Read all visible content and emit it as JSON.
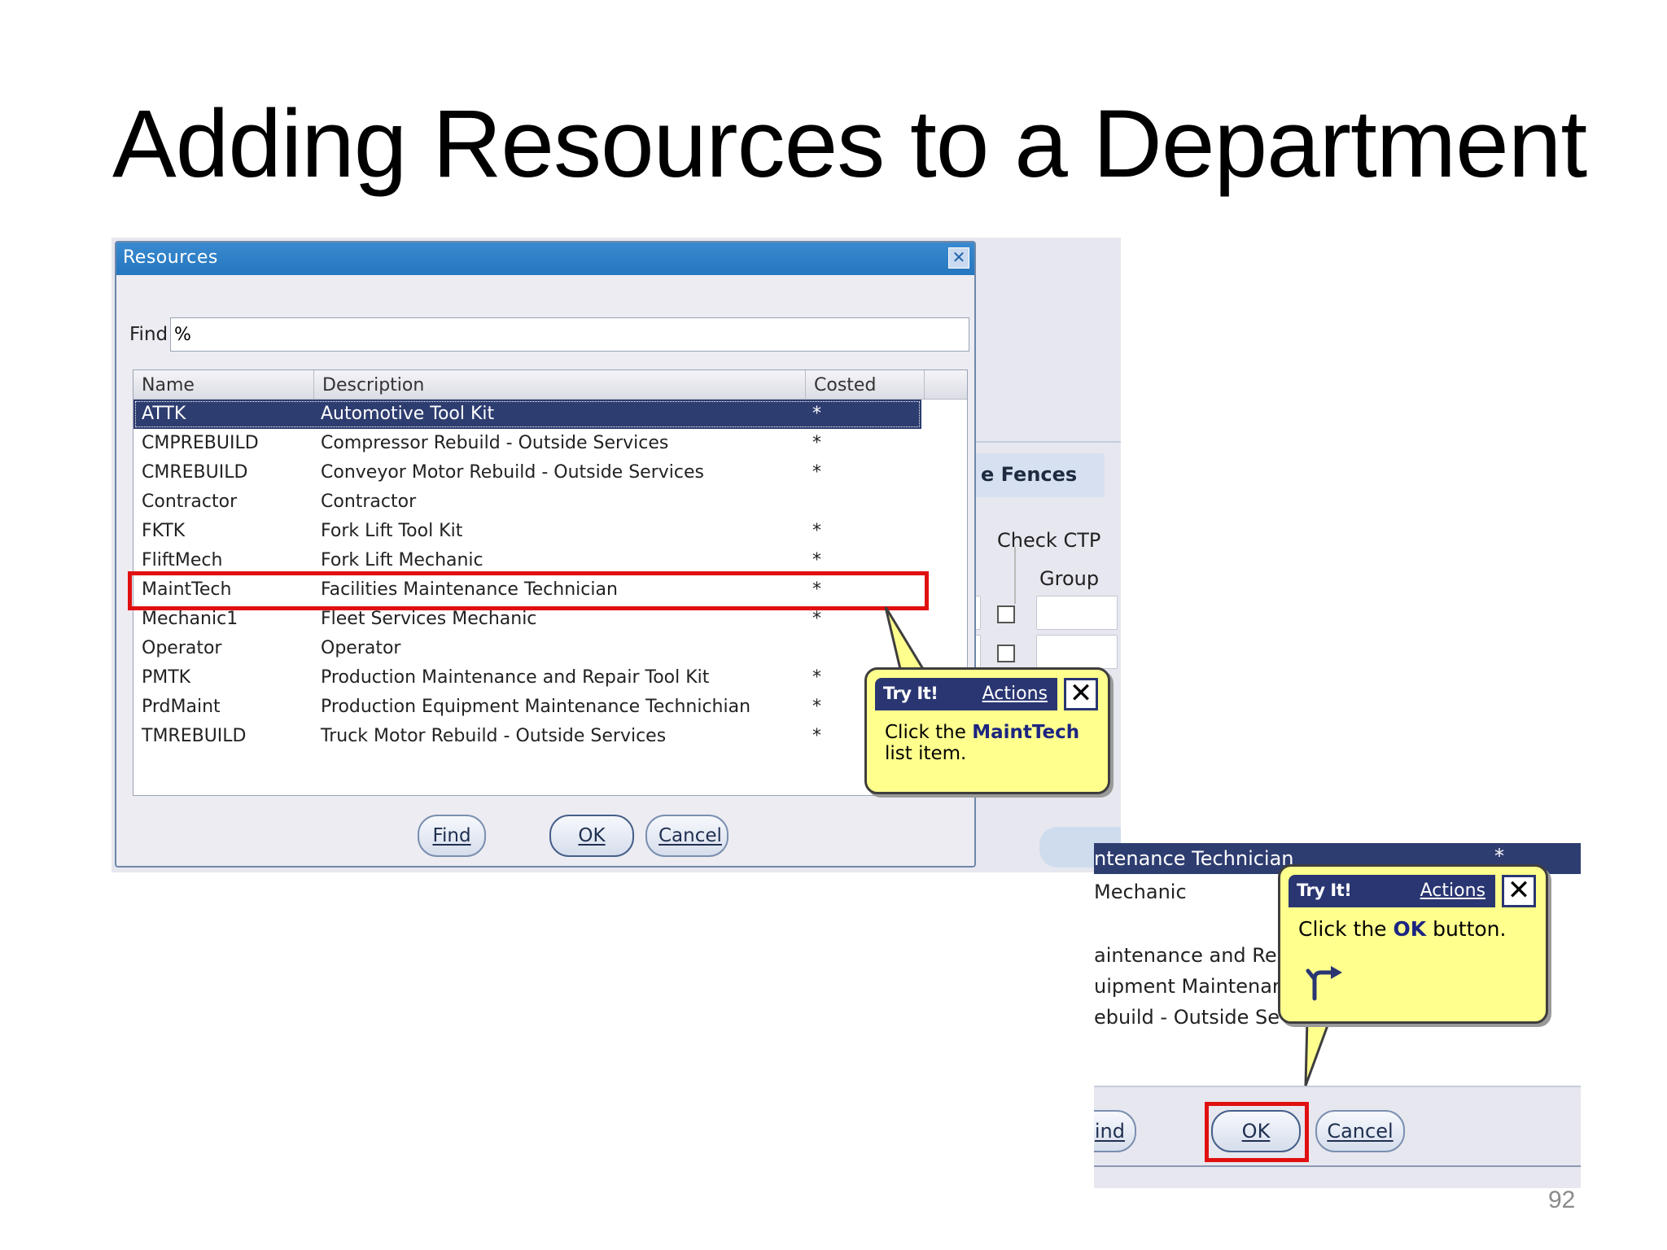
{
  "slide": {
    "title": "Adding Resources to a Department",
    "page_number": "92"
  },
  "dialog": {
    "title": "Resources",
    "close_glyph": "✕",
    "find_label": "Find",
    "find_value": "%",
    "columns": [
      "Name",
      "Description",
      "Costed"
    ],
    "rows": [
      {
        "name": "ATTK",
        "description": "Automotive Tool Kit",
        "costed": "*"
      },
      {
        "name": "CMPREBUILD",
        "description": "Compressor Rebuild - Outside Services",
        "costed": "*"
      },
      {
        "name": "CMREBUILD",
        "description": "Conveyor Motor Rebuild - Outside Services",
        "costed": "*"
      },
      {
        "name": "Contractor",
        "description": "Contractor",
        "costed": ""
      },
      {
        "name": "FKTK",
        "description": "Fork Lift Tool Kit",
        "costed": "*"
      },
      {
        "name": "FliftMech",
        "description": "Fork Lift Mechanic",
        "costed": "*"
      },
      {
        "name": "MaintTech",
        "description": "Facilities Maintenance Technician",
        "costed": "*"
      },
      {
        "name": "Mechanic1",
        "description": "Fleet Services Mechanic",
        "costed": "*"
      },
      {
        "name": "Operator",
        "description": "Operator",
        "costed": ""
      },
      {
        "name": "PMTK",
        "description": "Production Maintenance and Repair Tool Kit",
        "costed": "*"
      },
      {
        "name": "PrdMaint",
        "description": "Production Equipment Maintenance Technichian",
        "costed": "*"
      },
      {
        "name": "TMREBUILD",
        "description": "Truck Motor Rebuild - Outside Services",
        "costed": "*"
      }
    ],
    "buttons": {
      "find": "Find",
      "ok": "OK",
      "cancel": "Cancel"
    }
  },
  "background_form": {
    "tab_label": "e Fences",
    "check_ctp_label": "Check CTP",
    "group_label": "Group"
  },
  "tooltip1": {
    "header": "Try It!",
    "actions_link": "Actions",
    "close_glyph": "✕",
    "text_before": "Click the ",
    "text_bold": "MaintTech",
    "text_after": " list item."
  },
  "tooltip2": {
    "header": "Try It!",
    "actions_link": "Actions",
    "close_glyph": "✕",
    "text_before": "Click the ",
    "text_bold": "OK",
    "text_after": " button.",
    "icon": "branch-arrow-icon"
  },
  "shot2": {
    "selected_fragment": "ntenance Technician",
    "selected_costed": "*",
    "fragments": [
      "Mechanic",
      "aintenance and Rep",
      "uipment Maintenan",
      "ebuild - Outside Se"
    ],
    "buttons": {
      "find": "ind",
      "ok": "OK",
      "cancel": "Cancel"
    }
  },
  "colors": {
    "titlebar": "#2476be",
    "selection": "#2e3d70",
    "tooltip_bg": "#ffff8e",
    "highlight": "#e01010"
  }
}
